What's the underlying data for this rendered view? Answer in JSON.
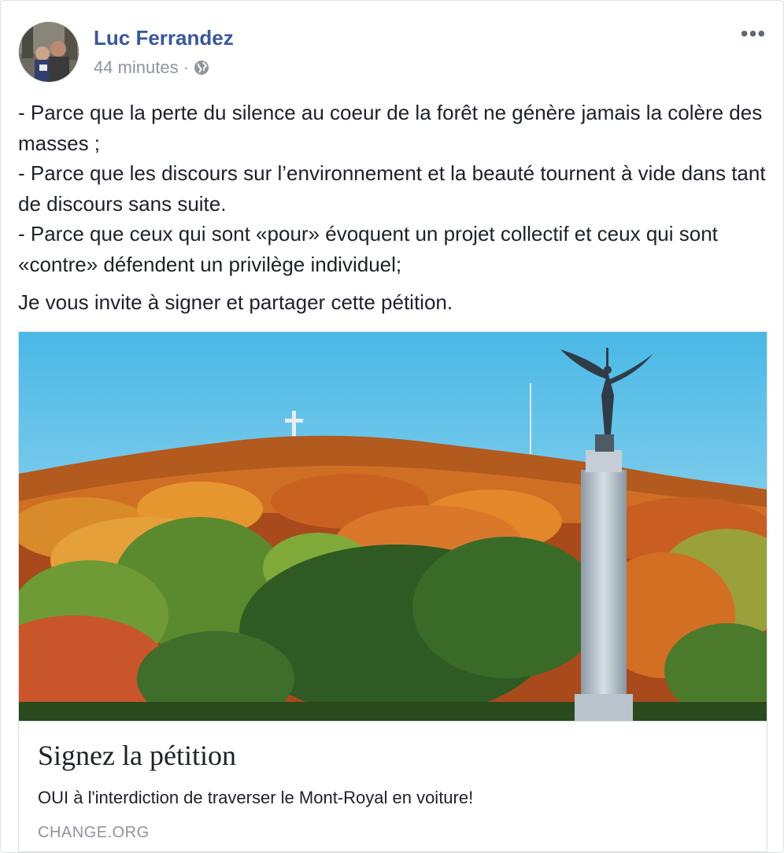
{
  "post": {
    "author": "Luc Ferrandez",
    "timestamp": "44 minutes",
    "separator": "·",
    "privacy_icon": "globe-icon",
    "more_label": "•••",
    "body": [
      "- Parce que la perte du silence au coeur de la forêt ne génère jamais la colère des masses ;",
      "- Parce que les discours sur l’environnement et la beauté tournent à vide dans tant de discours sans suite.",
      "- Parce que ceux qui sont «pour» évoquent un projet collectif et ceux qui sont «contre» défendent un privilège individuel;"
    ],
    "invite": "Je vous invite à signer et partager cette pétition."
  },
  "link": {
    "title": "Signez la pétition",
    "description": "OUI à l'interdiction de traverser le Mont-Royal en voiture!",
    "domain": "CHANGE.ORG"
  },
  "colors": {
    "author_link": "#385898",
    "meta_gray": "#90949c",
    "border": "#dadde1"
  }
}
